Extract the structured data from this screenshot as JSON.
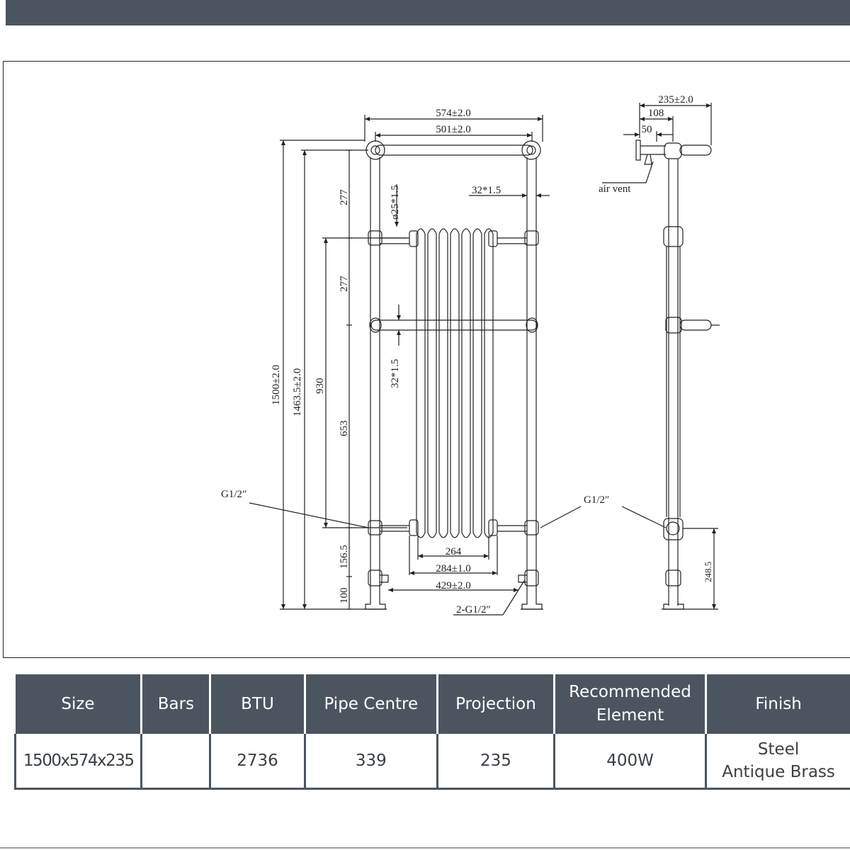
{
  "drawing": {
    "labels": {
      "w574": "574±2.0",
      "w501": "501±2.0",
      "d235": "235±2.0",
      "d108": "108",
      "d50": "50",
      "air_vent": "air vent",
      "pipe32_top": "32*1.5",
      "phi25": "ø25*1.5",
      "pipe32_mid": "32*1.5",
      "h1500": "1500±2.0",
      "h1463": "1463.5±2.0",
      "h930": "930",
      "h277a": "277",
      "h277b": "277",
      "h653": "653",
      "h156": "156.5",
      "h100": "100",
      "h248": "248.5",
      "g_left": "G1/2″",
      "g_right": "G1/2″",
      "w264": "264",
      "w284": "284±1.0",
      "w429": "429±2.0",
      "g_bottom": "2-G1/2″"
    }
  },
  "table": {
    "headers": [
      "Size",
      "Bars",
      "BTU",
      "Pipe  Centre",
      "Projection",
      "Recommended Element",
      "Finish"
    ],
    "row": {
      "size": "1500x574x235",
      "bars": "",
      "btu": "2736",
      "pipe_centre": "339",
      "projection": "235",
      "element": "400W",
      "finish_1": "Steel",
      "finish_2": "Antique  Brass"
    }
  },
  "colors": {
    "band": "#4b5560",
    "line": "#222222"
  }
}
